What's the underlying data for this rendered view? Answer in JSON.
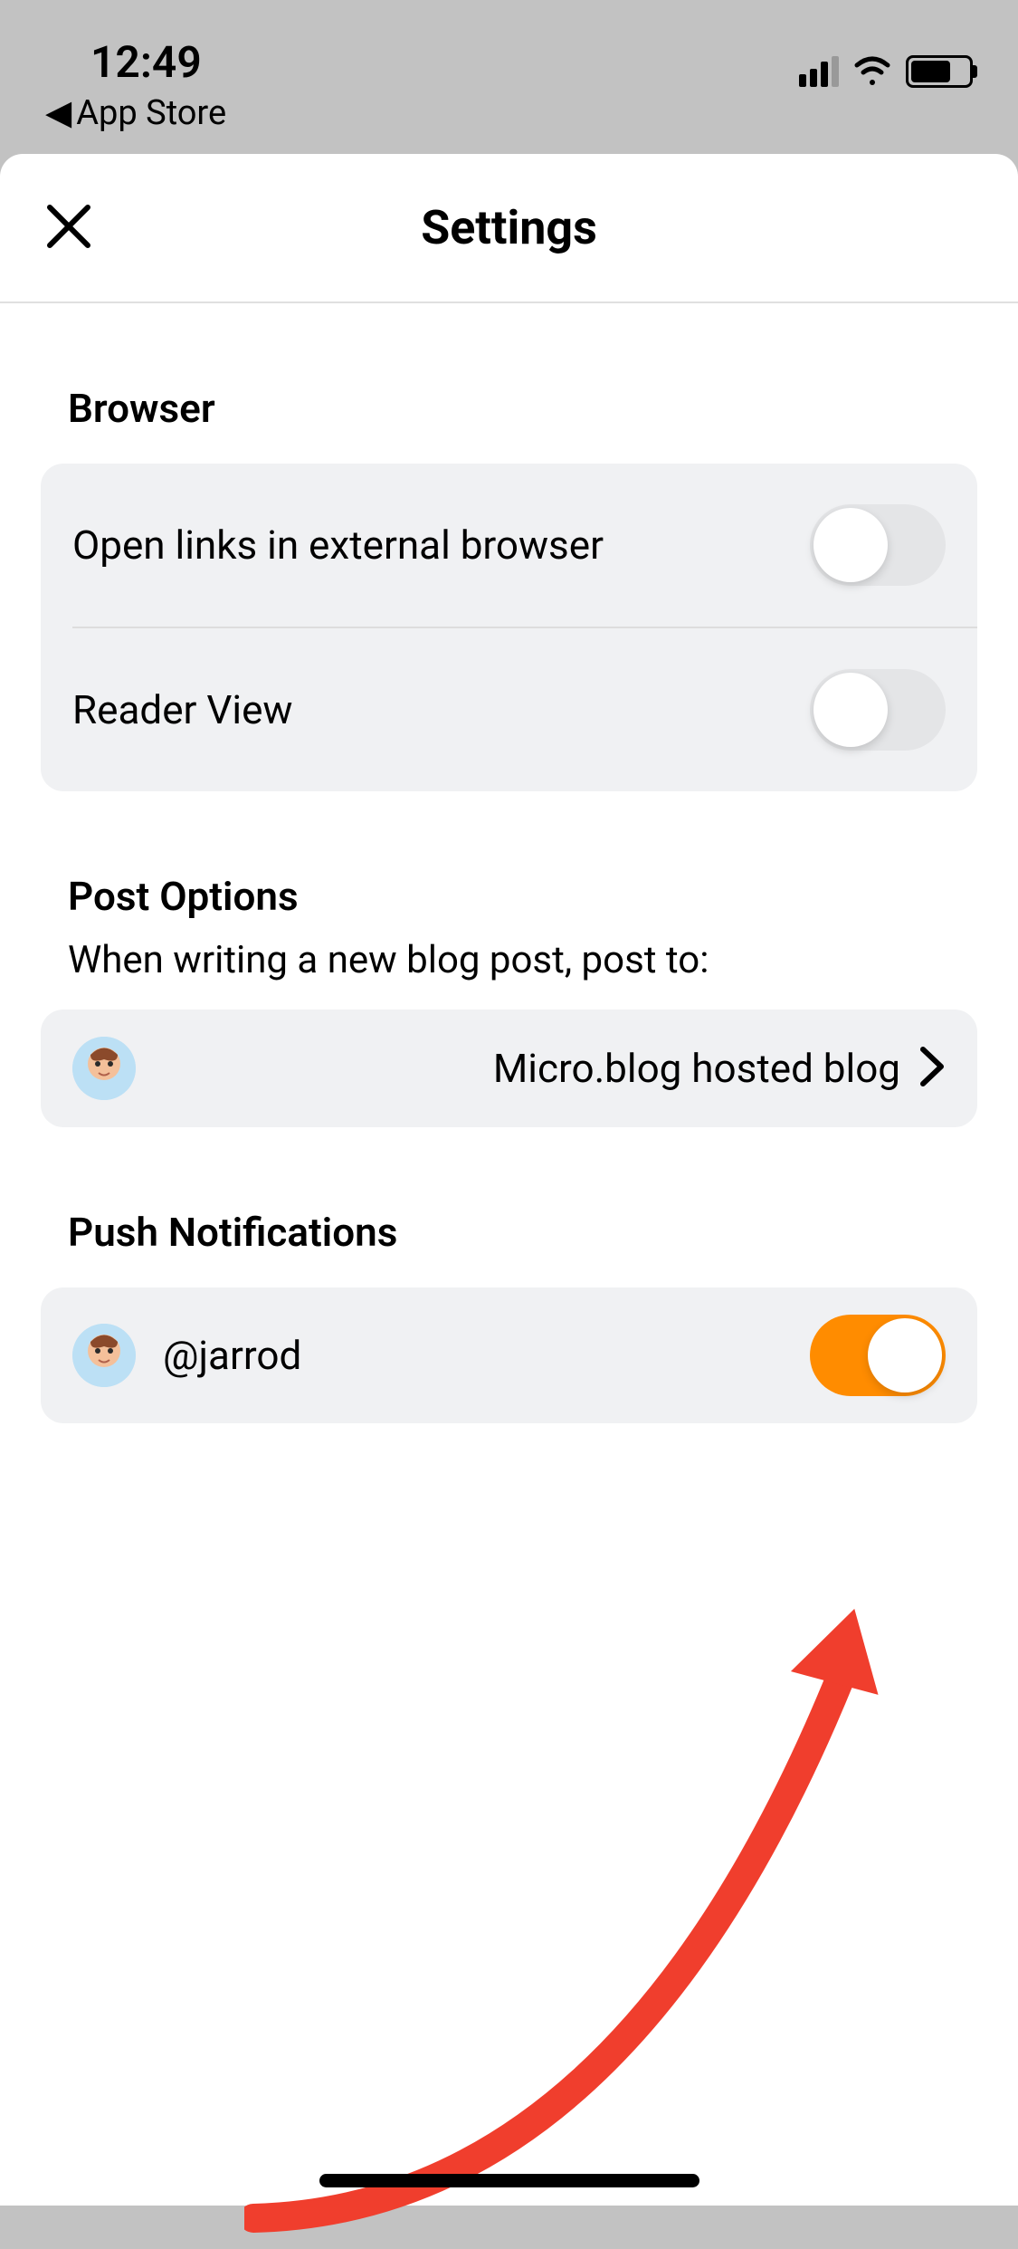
{
  "statusBar": {
    "time": "12:49",
    "backLabel": "App Store"
  },
  "header": {
    "title": "Settings"
  },
  "sections": {
    "browser": {
      "title": "Browser",
      "items": [
        {
          "label": "Open links in external browser",
          "on": false
        },
        {
          "label": "Reader View",
          "on": false
        }
      ]
    },
    "postOptions": {
      "title": "Post Options",
      "subtitle": "When writing a new blog post, post to:",
      "item": {
        "value": "Micro.blog hosted blog"
      }
    },
    "pushNotifications": {
      "title": "Push Notifications",
      "item": {
        "username": "@jarrod",
        "on": true
      }
    }
  }
}
